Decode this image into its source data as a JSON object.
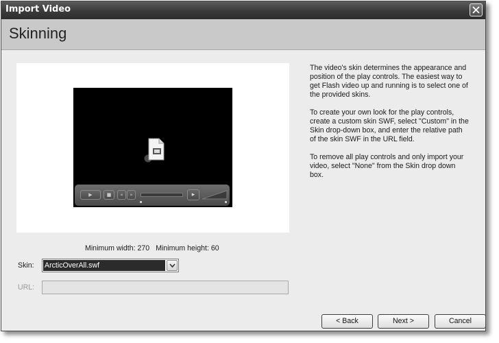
{
  "window": {
    "title": "Import Video"
  },
  "header": {
    "title": "Skinning"
  },
  "preview": {
    "min_width_label": "Minimum width: 270",
    "min_height_label": "Minimum height: 60"
  },
  "info": {
    "paragraphs": [
      "The video's skin determines the appearance and position of the play controls.  The easiest way to get Flash video up and running is to select one of the provided skins.",
      "To create your own look for the play controls, create a custom skin SWF, select \"Custom\" in the Skin drop-down box, and enter the relative path of the skin SWF in the URL field.",
      "To remove all play controls and only import your video, select \"None\" from the Skin drop down box."
    ]
  },
  "form": {
    "skin_label": "Skin:",
    "skin_value": "ArcticOverAll.swf",
    "url_label": "URL:",
    "url_value": ""
  },
  "buttons": {
    "back": "< Back",
    "next": "Next >",
    "cancel": "Cancel"
  },
  "colors": {
    "title_bar": "#3a3a3a",
    "header_band": "#c9c9c9",
    "dialog_bg": "#ececec",
    "selected_value": "#2b2b2b",
    "disabled_text": "#9a9a9a"
  },
  "icons": [
    "close-icon",
    "file-icon",
    "play-icon",
    "stop-icon",
    "rewind-icon",
    "forward-icon",
    "volume-icon",
    "chevron-down-icon"
  ]
}
